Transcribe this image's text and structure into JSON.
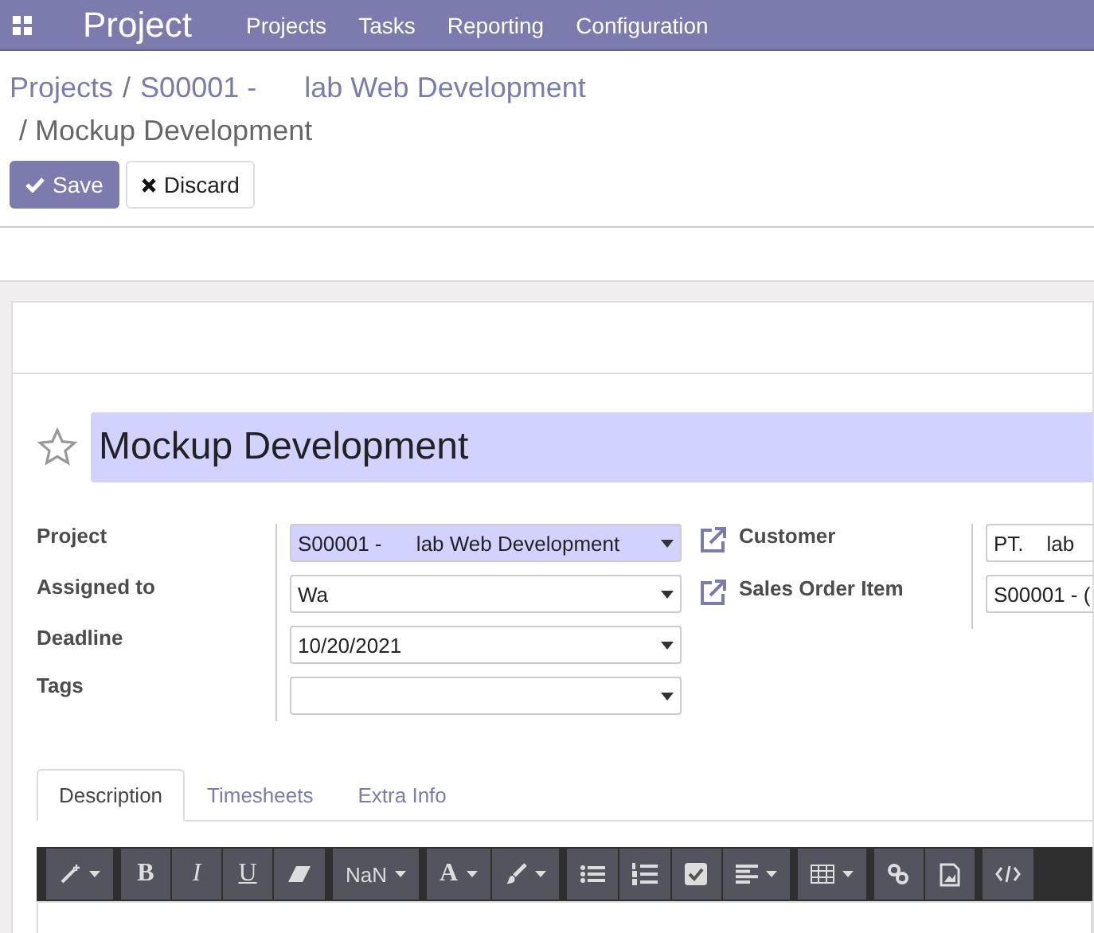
{
  "navbar": {
    "app_name": "Project",
    "menu": [
      "Projects",
      "Tasks",
      "Reporting",
      "Configuration"
    ]
  },
  "breadcrumb": {
    "links": [
      "Projects",
      "S00001 -      lab Web Development"
    ],
    "separators": [
      "/"
    ],
    "current": "/ Mockup Development"
  },
  "actions": [
    {
      "label": "Save",
      "kind": "primary"
    },
    {
      "label": "Discard",
      "kind": "secondary"
    }
  ],
  "task": {
    "starred": false,
    "title": "Mockup Development"
  },
  "left_fields": [
    {
      "label": "Project",
      "value": "S00001 -      lab Web Development",
      "highlighted": true
    },
    {
      "label": "Assigned to",
      "value": "Wa",
      "highlighted": false
    },
    {
      "label": "Deadline",
      "value": "10/20/2021",
      "highlighted": false
    },
    {
      "label": "Tags",
      "highlighted": false
    }
  ],
  "right_fields": [
    {
      "label": "Customer",
      "value": "PT.    lab"
    },
    {
      "label": "Sales Order Item",
      "value": "S00001 - ("
    }
  ],
  "tabs": [
    {
      "label": "Description",
      "selected": true
    },
    {
      "label": "Timesheets",
      "selected": false
    },
    {
      "label": "Extra Info",
      "selected": false
    }
  ],
  "toolbar": [
    [
      {
        "kind": "magic",
        "dropdown": true
      }
    ],
    [
      {
        "kind": "bold",
        "label": "B"
      },
      {
        "kind": "italic",
        "label": "I"
      },
      {
        "kind": "underline",
        "label": "U"
      },
      {
        "kind": "eraser"
      }
    ],
    [
      {
        "kind": "text",
        "label": "NaN",
        "dropdown": true
      }
    ],
    [
      {
        "kind": "bold",
        "label": "A",
        "dropdown": true
      },
      {
        "kind": "brush",
        "dropdown": true
      }
    ],
    [
      {
        "kind": "ul"
      },
      {
        "kind": "ol"
      },
      {
        "kind": "check"
      },
      {
        "kind": "align",
        "dropdown": true
      }
    ],
    [
      {
        "kind": "table",
        "dropdown": true
      }
    ],
    [
      {
        "kind": "link"
      },
      {
        "kind": "image"
      }
    ],
    [
      {
        "kind": "code"
      }
    ]
  ]
}
